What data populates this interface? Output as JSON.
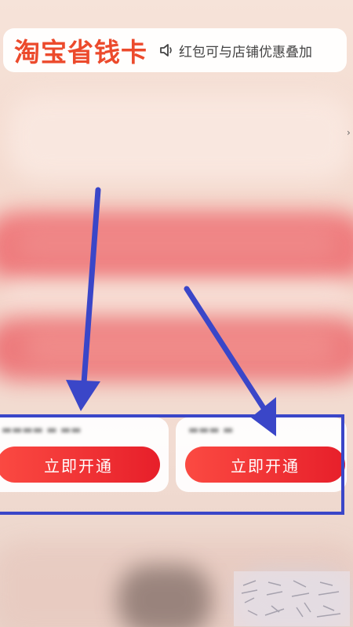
{
  "header": {
    "title": "淘宝省钱卡",
    "notice_icon": "speaker-icon",
    "notice_text": "红包可与店铺优惠叠加"
  },
  "cards": [
    {
      "button_label": "立即开通"
    },
    {
      "button_label": "立即开通"
    }
  ],
  "colors": {
    "title_red": "#ec4a2c",
    "button_red": "#e71f2a",
    "annotation_blue": "#3a46c8"
  },
  "side_icon": "chevron-right-icon"
}
